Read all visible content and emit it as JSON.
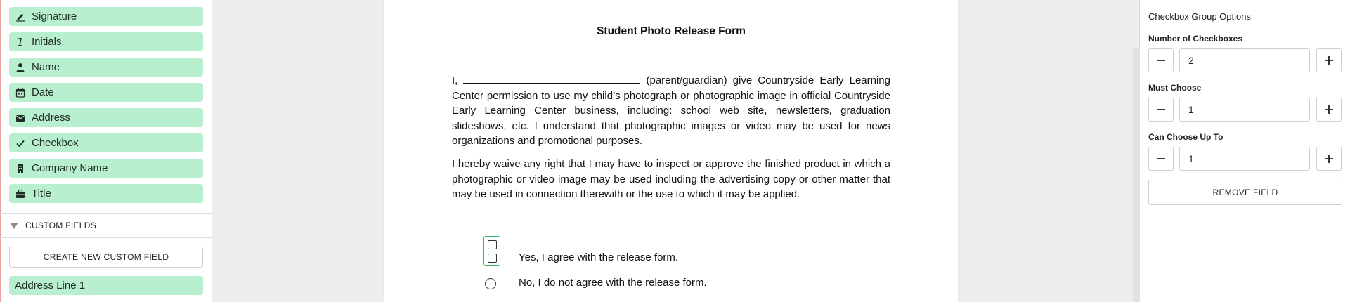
{
  "sidebar": {
    "fields": [
      {
        "label": "Signature",
        "icon": "pen-icon"
      },
      {
        "label": "Initials",
        "icon": "text-cursor-icon"
      },
      {
        "label": "Name",
        "icon": "person-icon"
      },
      {
        "label": "Date",
        "icon": "calendar-icon"
      },
      {
        "label": "Address",
        "icon": "envelope-icon"
      },
      {
        "label": "Checkbox",
        "icon": "checkmark-icon"
      },
      {
        "label": "Company Name",
        "icon": "building-icon"
      },
      {
        "label": "Title",
        "icon": "briefcase-icon"
      }
    ],
    "custom_fields_header": "CUSTOM FIELDS",
    "create_button": "CREATE NEW CUSTOM FIELD",
    "custom_fields": [
      {
        "label": "Address Line 1"
      }
    ],
    "field_color": "#b8efcf"
  },
  "document": {
    "title": "Student Photo Release Form",
    "para1_start": "I,",
    "para1_rest": " (parent/guardian) give Countryside Early Learning Center permission to use my child’s photograph or photographic image in official Countryside Early Learning Center business, including:  school web site, newsletters, graduation slideshows, etc.  I understand that photographic images or video may be used for news organizations and promotional purposes.",
    "para2": "I hereby waive any right that I may have to inspect or approve the finished product in which a photographic or video image may be used including the advertising copy or other matter that may be used in connection therewith or the use to which it may be applied.",
    "option_yes": "Yes, I agree with the release form.",
    "option_no": "No, I do not agree with the release form."
  },
  "panel": {
    "title": "Checkbox Group Options",
    "number_label": "Number of Checkboxes",
    "number_value": "2",
    "must_label": "Must Choose",
    "must_value": "1",
    "can_label": "Can Choose Up To",
    "can_value": "1",
    "remove_button": "REMOVE FIELD",
    "accent_color": "#3db26a"
  }
}
